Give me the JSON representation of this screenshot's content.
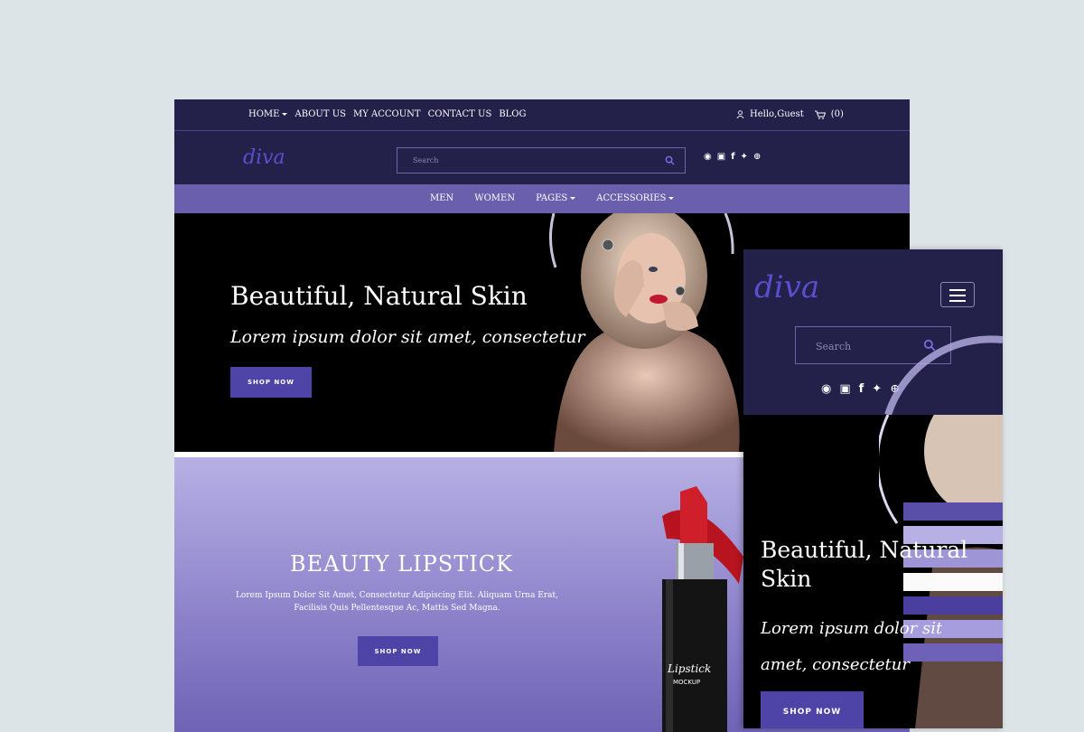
{
  "desktop": {
    "topnav": [
      "HOME",
      "ABOUT US",
      "MY ACCOUNT",
      "CONTACT US",
      "BLOG"
    ],
    "greeting": "Hello,Guest",
    "cart_count": "(0)",
    "logo": "diva",
    "search_placeholder": "Search",
    "mainnav": [
      "MEN",
      "WOMEN",
      "PAGES",
      "ACCESSORIES"
    ],
    "hero": {
      "title": "Beautiful, Natural Skin",
      "subtitle": "Lorem ipsum dolor sit amet, consectetur",
      "button": "SHOP NOW"
    },
    "lipstick": {
      "title": "BEAUTY LIPSTICK",
      "text_line1": "Lorem Ipsum Dolor Sit Amet, Consectetur Adipiscing Elit. Aliquam Urna Erat,",
      "text_line2": "Facilisis Quis Pellentesque Ac, Mattis Sed Magna.",
      "button": "SHOP NOW",
      "product_label_script": "Lipstick",
      "product_label": "MOCKUP"
    }
  },
  "mobile": {
    "logo": "diva",
    "search_placeholder": "Search",
    "hero": {
      "title": "Beautiful, Natural Skin",
      "subtitle": "Lorem ipsum dolor sit amet, consectetur",
      "button": "SHOP NOW"
    }
  },
  "colors": {
    "dark_navy": "#23204a",
    "nav_purple": "#6a5fac",
    "button_purple": "#4e43a6",
    "logo_purple": "#5a4fcf",
    "lipstick_red": "#c81e2a"
  },
  "icons": [
    "user-icon",
    "cart-icon",
    "search-icon",
    "pinterest-icon",
    "instagram-icon",
    "facebook-icon",
    "twitter-icon",
    "dribbble-icon",
    "hamburger-menu-icon"
  ]
}
